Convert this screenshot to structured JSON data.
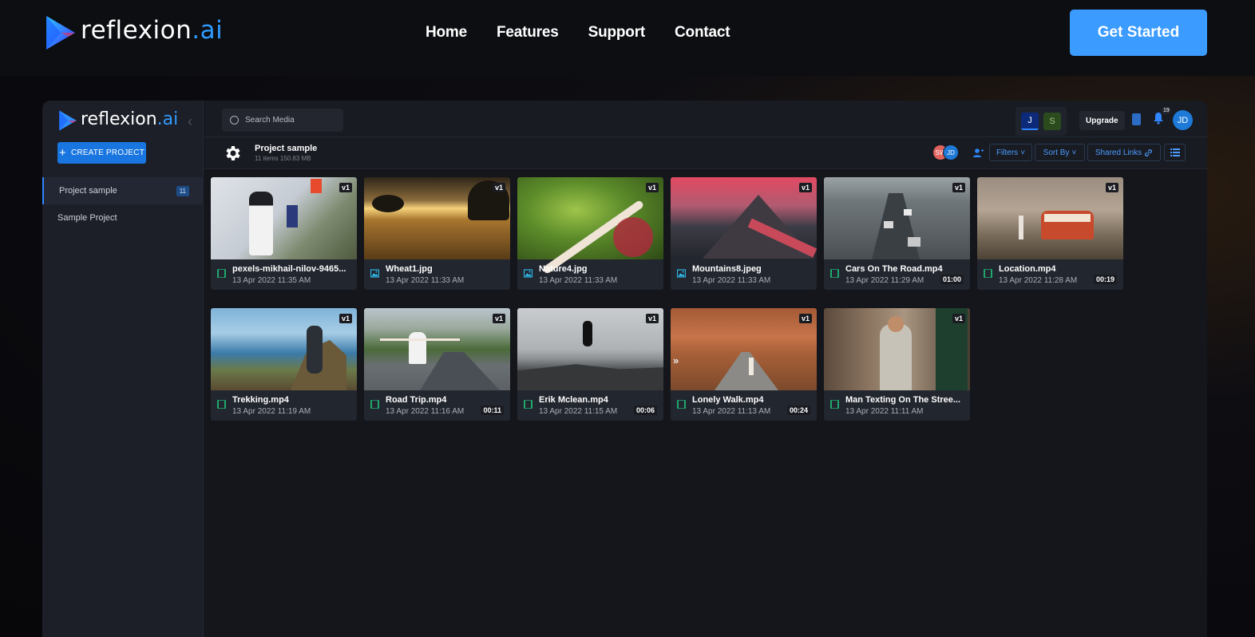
{
  "site": {
    "brand_name": "reflexion",
    "brand_suffix": ".ai",
    "nav": [
      "Home",
      "Features",
      "Support",
      "Contact"
    ],
    "cta": "Get Started",
    "accent": "#3b9bff"
  },
  "app": {
    "brand_name": "reflexion",
    "brand_suffix": ".ai",
    "collapse_icon": "chevron-left-icon",
    "create_label": "CREATE PROJECT",
    "projects": [
      {
        "name": "Project sample",
        "count": "11",
        "active": true
      },
      {
        "name": "Sample Project",
        "active": false
      }
    ],
    "search_placeholder": "Search Media",
    "workspaces": [
      "J",
      "S"
    ],
    "upgrade_label": "Upgrade",
    "notification_count": "19",
    "user_initials": "JD",
    "project": {
      "title": "Project sample",
      "meta": "11 items 150.83 MB"
    },
    "collaborators": [
      "SW",
      "JD"
    ],
    "toolbar": {
      "filters": "Filters",
      "sort_by": "Sort By",
      "shared_links": "Shared Links"
    },
    "media": [
      {
        "name": "pexels-mikhail-nilov-9465...",
        "date": "13 Apr 2022 11:35 AM",
        "version": "v1",
        "duration": "",
        "kind": "video"
      },
      {
        "name": "Wheat1.jpg",
        "date": "13 Apr 2022 11:33 AM",
        "version": "v1",
        "duration": "",
        "kind": "image"
      },
      {
        "name": "Nature4.jpg",
        "date": "13 Apr 2022 11:33 AM",
        "version": "v1",
        "duration": "",
        "kind": "image"
      },
      {
        "name": "Mountains8.jpeg",
        "date": "13 Apr 2022 11:33 AM",
        "version": "v1",
        "duration": "",
        "kind": "image"
      },
      {
        "name": "Cars On The Road.mp4",
        "date": "13 Apr 2022 11:29 AM",
        "version": "v1",
        "duration": "01:00",
        "kind": "video"
      },
      {
        "name": "Location.mp4",
        "date": "13 Apr 2022 11:28 AM",
        "version": "v1",
        "duration": "00:19",
        "kind": "video"
      },
      {
        "name": "Trekking.mp4",
        "date": "13 Apr 2022 11:19 AM",
        "version": "v1",
        "duration": "",
        "kind": "video"
      },
      {
        "name": "Road Trip.mp4",
        "date": "13 Apr 2022 11:16 AM",
        "version": "v1",
        "duration": "00:11",
        "kind": "video"
      },
      {
        "name": "Erik Mclean.mp4",
        "date": "13 Apr 2022 11:15 AM",
        "version": "v1",
        "duration": "00:06",
        "kind": "video"
      },
      {
        "name": "Lonely Walk.mp4",
        "date": "13 Apr 2022 11:13 AM",
        "version": "v1",
        "duration": "00:24",
        "kind": "video"
      },
      {
        "name": "Man Texting On The Stree...",
        "date": "13 Apr 2022 11:11 AM",
        "version": "v1",
        "duration": "",
        "kind": "video"
      }
    ]
  }
}
